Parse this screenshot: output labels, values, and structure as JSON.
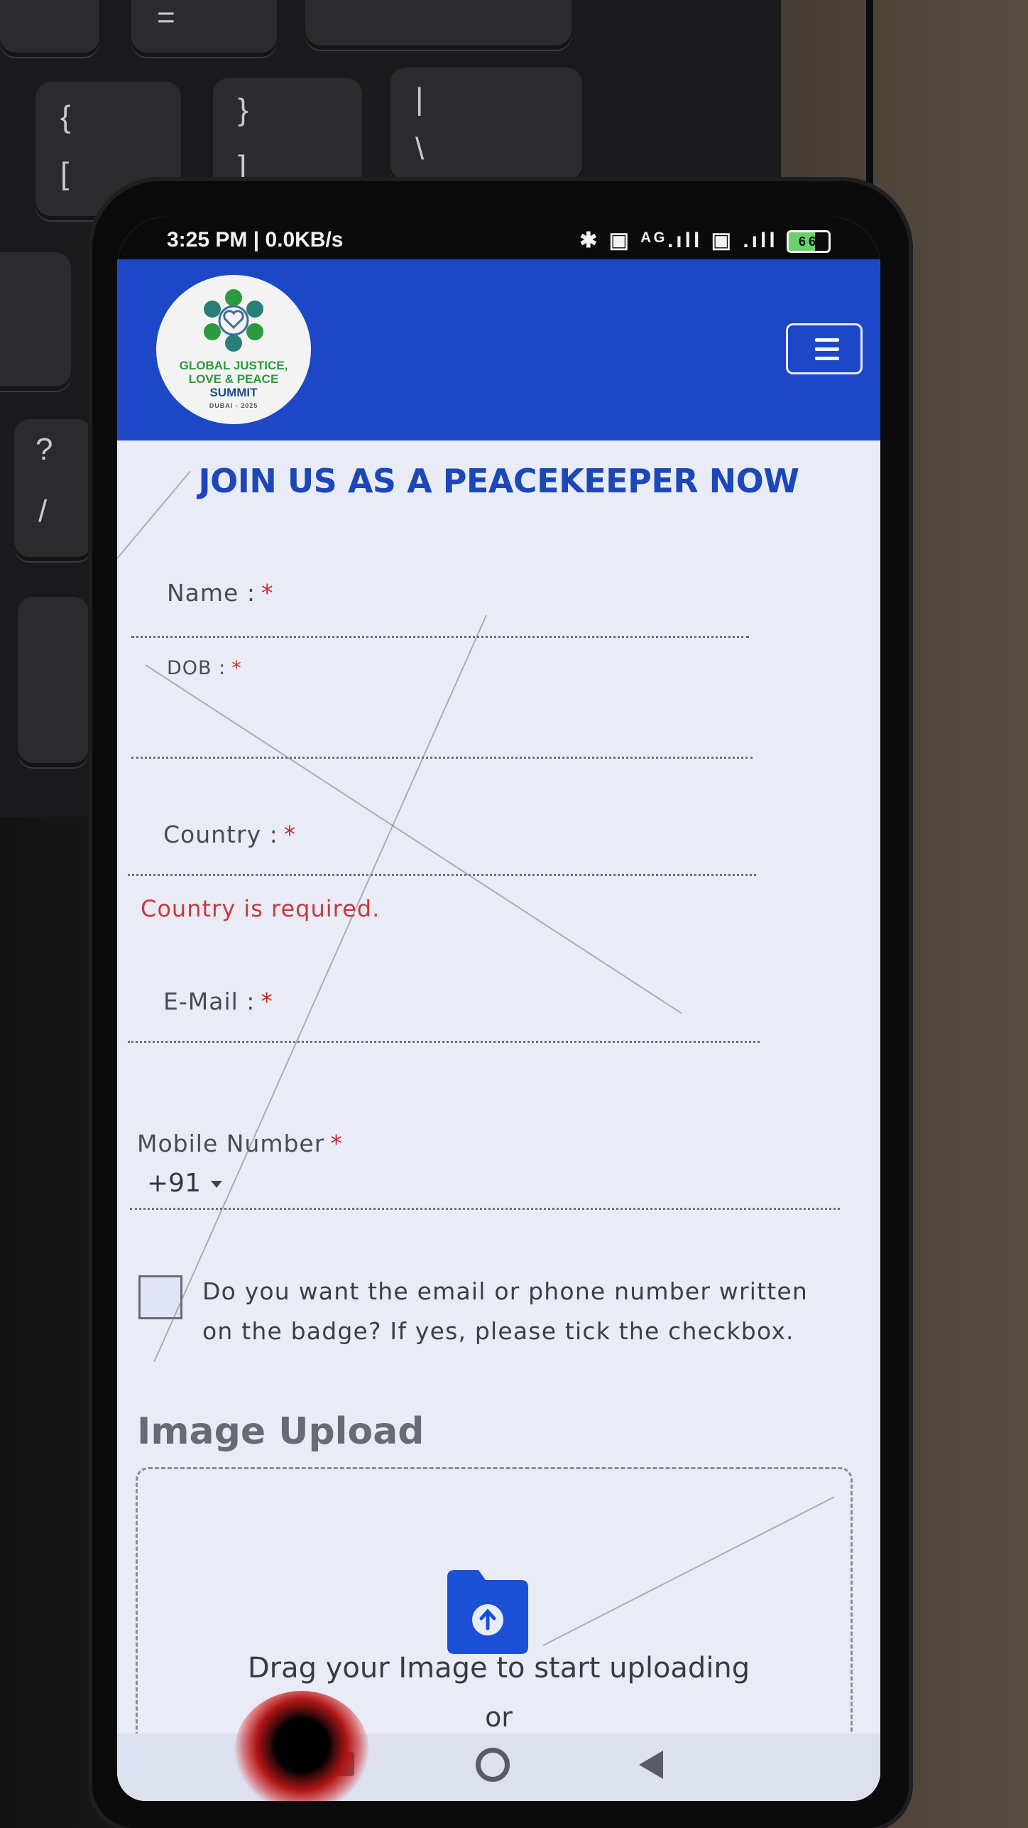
{
  "status_bar": {
    "time": "3:25 PM | 0.0KB/s",
    "right_icons": "✱ ▣ ᴬᴳ.ıll ▣ .ıll",
    "battery_level": "66"
  },
  "header": {
    "logo": {
      "line1": "GLOBAL JUSTICE,",
      "line2": "LOVE & PEACE",
      "line3": "SUMMIT",
      "line4": "DUBAI - 2025"
    },
    "menu_icon": "hamburger-icon"
  },
  "form": {
    "title": "JOIN US AS A PEACEKEEPER NOW",
    "name_label": "Name :",
    "dob_label": "DOB :",
    "country_label": "Country :",
    "country_error": "Country is required.",
    "email_label": "E-Mail :",
    "mobile_label": "Mobile Number",
    "country_code": "+91",
    "required_mark": "*",
    "badge_checkbox_label": "Do you want the email or phone number written on the badge? If yes, please tick the checkbox.",
    "badge_checkbox_checked": false
  },
  "upload": {
    "heading": "Image Upload",
    "drag_text": "Drag your Image to start uploading",
    "or_text": "or",
    "icon": "folder-upload-icon",
    "icon_color": "#1a4fd6"
  },
  "keyboard_keys": [
    "=",
    "{",
    "[",
    "}",
    "]",
    "|",
    "\\",
    "?",
    "/"
  ],
  "colors": {
    "header_bg": "#1c48c8",
    "title": "#1c47b8",
    "required": "#d02a2a",
    "error": "#c83a3a"
  }
}
